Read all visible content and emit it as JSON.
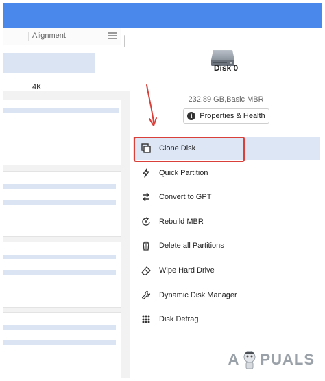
{
  "left_panel": {
    "column_header": "Alignment",
    "row_value": "4K"
  },
  "disk": {
    "name": "Disk 0",
    "info": "232.89 GB,Basic MBR",
    "properties_button": "Properties & Health"
  },
  "menu": [
    {
      "label": "Clone Disk",
      "icon": "clone-icon",
      "active": true
    },
    {
      "label": "Quick Partition",
      "icon": "lightning-icon"
    },
    {
      "label": "Convert to GPT",
      "icon": "convert-arrows-icon"
    },
    {
      "label": "Rebuild MBR",
      "icon": "rebuild-icon"
    },
    {
      "label": "Delete all Partitions",
      "icon": "trash-icon"
    },
    {
      "label": "Wipe Hard Drive",
      "icon": "eraser-icon"
    },
    {
      "label": "Dynamic Disk Manager",
      "icon": "wrench-icon"
    },
    {
      "label": "Disk Defrag",
      "icon": "defrag-icon"
    }
  ],
  "watermark": {
    "left": "A",
    "right": "PUALS"
  },
  "colors": {
    "titlebar": "#4a88ec",
    "highlight_border": "#d9403a",
    "active_row": "#dde6f4",
    "selection_bar": "#dbe4f3"
  }
}
